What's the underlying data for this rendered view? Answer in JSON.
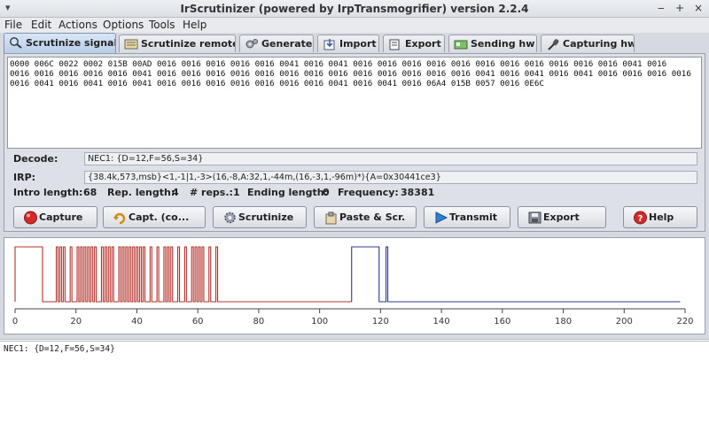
{
  "window": {
    "title": "IrScrutinizer (powered by IrpTransmogrifier) version 2.2.4",
    "window_menu_glyph": "▾",
    "minimize_glyph": "‒",
    "maximize_glyph": "+",
    "close_glyph": "×"
  },
  "menu": {
    "file": "File",
    "edit": "Edit",
    "actions": "Actions",
    "options": "Options",
    "tools": "Tools",
    "help": "Help"
  },
  "tabs": [
    {
      "label": "Scrutinize signal",
      "icon": "magnifier-icon",
      "active": true
    },
    {
      "label": "Scrutinize remote",
      "icon": "remote-icon",
      "active": false
    },
    {
      "label": "Generate",
      "icon": "gears-icon",
      "active": false
    },
    {
      "label": "Import",
      "icon": "import-icon",
      "active": false
    },
    {
      "label": "Export",
      "icon": "export-icon",
      "active": false
    },
    {
      "label": "Sending hw",
      "icon": "sending-hw-icon",
      "active": false
    },
    {
      "label": "Capturing hw",
      "icon": "microphone-icon",
      "active": false
    }
  ],
  "signal": {
    "raw_text": "0000 006C 0022 0002 015B 00AD 0016 0016 0016 0016 0016 0041 0016 0041 0016 0016 0016 0016 0016 0016 0016 0016 0016 0016 0016 0041 0016\n0016 0016 0016 0016 0016 0041 0016 0016 0016 0016 0016 0016 0016 0016 0016 0016 0016 0016 0016 0041 0016 0041 0016 0041 0016 0016 0016 0016\n0016 0041 0016 0041 0016 0041 0016 0016 0016 0016 0016 0016 0016 0041 0016 0041 0016 06A4 015B 0057 0016 0E6C",
    "decode_label": "Decode:",
    "decode_value": "NEC1: {D=12,F=56,S=34}",
    "irp_label": "IRP:",
    "irp_value": "{38.4k,573,msb}<1,-1|1,-3>(16,-8,A:32,1,-44m,(16,-3,1,-96m)*){A=0x30441ce3}",
    "intro_length_label": "Intro length:",
    "intro_length": "68",
    "rep_length_label": "Rep. length:",
    "rep_length": "4",
    "reps_label": "# reps.:",
    "reps": "1",
    "ending_length_label": "Ending length:",
    "ending_length": "0",
    "frequency_label": "Frequency:",
    "frequency": "38381"
  },
  "buttons": {
    "capture": "Capture",
    "capt_continuous": "Capt. (co...",
    "scrutinize": "Scrutinize",
    "paste_scr": "Paste & Scr.",
    "transmit": "Transmit",
    "export": "Export",
    "help": "Help"
  },
  "colors": {
    "intro_series": "#b5322b",
    "repeat_series": "#2e3a8c",
    "capture_icon": "#d42a2a",
    "help_icon": "#d42a2a",
    "transmit_icon": "#2f7fd0"
  },
  "chart_data": {
    "type": "line",
    "title": "",
    "xlabel": "",
    "ylabel": "",
    "xlim": [
      0,
      220
    ],
    "x_ticks": [
      0,
      20,
      40,
      60,
      80,
      100,
      120,
      140,
      160,
      180,
      200,
      220
    ],
    "note_units": "ms",
    "series": [
      {
        "name": "",
        "color": "#b5322b",
        "segments_on_off_us": [
          9032,
          4507,
          572,
          572,
          572,
          572,
          572,
          1697,
          572,
          1697,
          572,
          572,
          572,
          572,
          572,
          572,
          572,
          572,
          572,
          572,
          572,
          1697,
          572,
          572,
          572,
          572,
          572,
          572,
          572,
          1697,
          572,
          572,
          572,
          572,
          572,
          572,
          572,
          572,
          572,
          572,
          572,
          572,
          572,
          572,
          572,
          1697,
          572,
          1697,
          572,
          1697,
          572,
          572,
          572,
          572,
          572,
          1697,
          572,
          1697,
          572,
          1697,
          572,
          572,
          572,
          572,
          572,
          572,
          572,
          1697,
          572,
          1697,
          572,
          44000
        ]
      },
      {
        "name": "",
        "color": "#2e3a8c",
        "segments_on_off_us": [
          9032,
          2267,
          572,
          96000
        ]
      }
    ]
  },
  "console": {
    "text": "NEC1: {D=12,F=56,S=34}"
  }
}
